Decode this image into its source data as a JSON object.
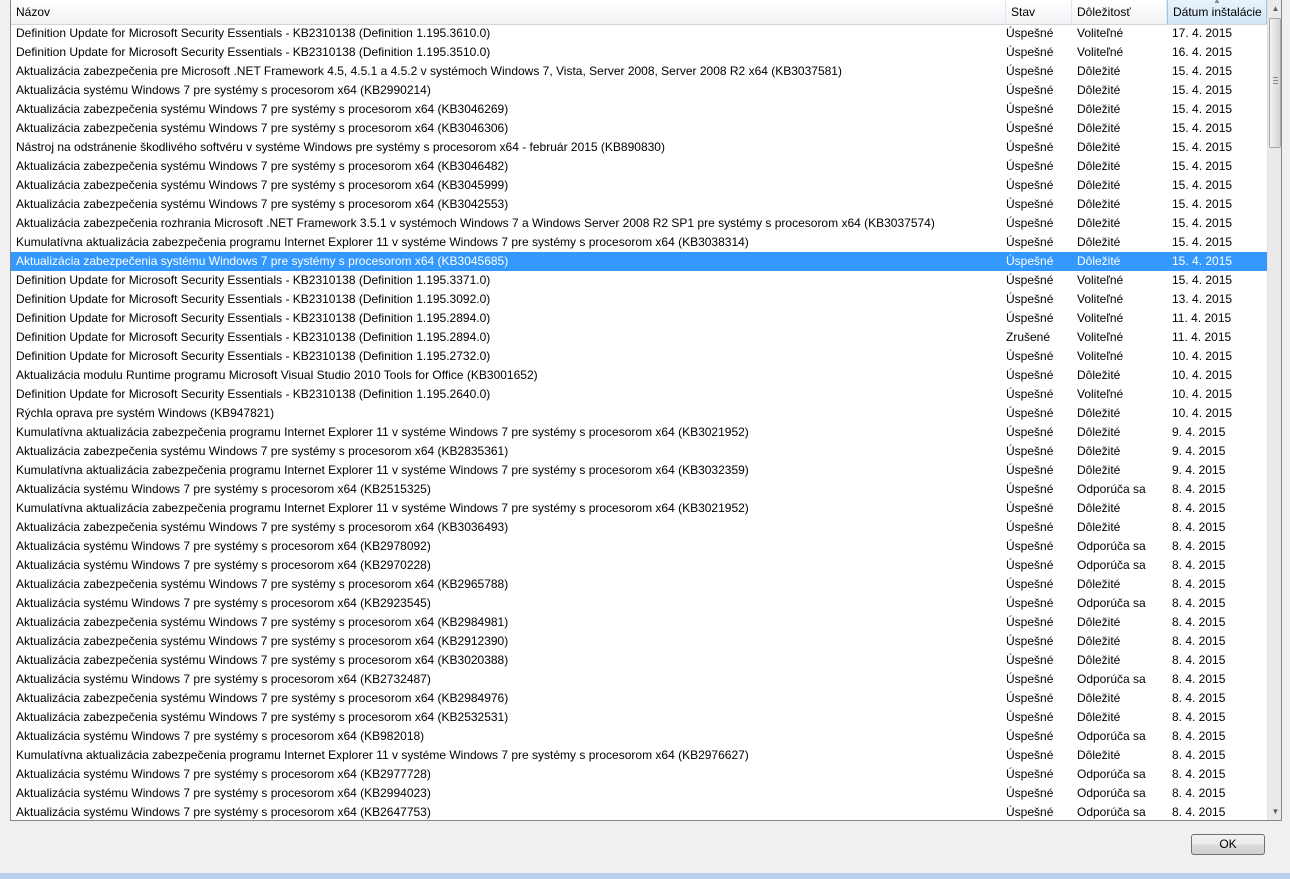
{
  "columns": {
    "name": "Názov",
    "stav": "Stav",
    "dolezitost": "Dôležitosť",
    "datum": "Dátum inštalácie"
  },
  "rows": [
    {
      "name": "Definition Update for Microsoft Security Essentials - KB2310138 (Definition 1.195.3610.0)",
      "stav": "Úspešné",
      "dol": "Voliteľné",
      "dat": "17. 4. 2015"
    },
    {
      "name": "Definition Update for Microsoft Security Essentials - KB2310138 (Definition 1.195.3510.0)",
      "stav": "Úspešné",
      "dol": "Voliteľné",
      "dat": "16. 4. 2015"
    },
    {
      "name": "Aktualizácia zabezpečenia pre Microsoft .NET Framework 4.5, 4.5.1 a 4.5.2 v systémoch Windows 7, Vista, Server 2008, Server 2008 R2 x64 (KB3037581)",
      "stav": "Úspešné",
      "dol": "Dôležité",
      "dat": "15. 4. 2015"
    },
    {
      "name": "Aktualizácia systému Windows 7 pre systémy s procesorom x64 (KB2990214)",
      "stav": "Úspešné",
      "dol": "Dôležité",
      "dat": "15. 4. 2015"
    },
    {
      "name": "Aktualizácia zabezpečenia systému Windows 7 pre systémy s procesorom x64 (KB3046269)",
      "stav": "Úspešné",
      "dol": "Dôležité",
      "dat": "15. 4. 2015"
    },
    {
      "name": "Aktualizácia zabezpečenia systému Windows 7 pre systémy s procesorom x64 (KB3046306)",
      "stav": "Úspešné",
      "dol": "Dôležité",
      "dat": "15. 4. 2015"
    },
    {
      "name": "Nástroj na odstránenie škodlivého softvéru v systéme Windows pre systémy s procesorom x64 - február 2015 (KB890830)",
      "stav": "Úspešné",
      "dol": "Dôležité",
      "dat": "15. 4. 2015"
    },
    {
      "name": "Aktualizácia zabezpečenia systému Windows 7 pre systémy s procesorom x64 (KB3046482)",
      "stav": "Úspešné",
      "dol": "Dôležité",
      "dat": "15. 4. 2015"
    },
    {
      "name": "Aktualizácia zabezpečenia systému Windows 7 pre systémy s procesorom x64 (KB3045999)",
      "stav": "Úspešné",
      "dol": "Dôležité",
      "dat": "15. 4. 2015"
    },
    {
      "name": "Aktualizácia zabezpečenia systému Windows 7 pre systémy s procesorom x64 (KB3042553)",
      "stav": "Úspešné",
      "dol": "Dôležité",
      "dat": "15. 4. 2015"
    },
    {
      "name": "Aktualizácia zabezpečenia rozhrania Microsoft .NET Framework 3.5.1 v systémoch Windows 7 a Windows Server 2008 R2 SP1 pre systémy s procesorom x64 (KB3037574)",
      "stav": "Úspešné",
      "dol": "Dôležité",
      "dat": "15. 4. 2015"
    },
    {
      "name": "Kumulatívna aktualizácia zabezpečenia programu Internet Explorer 11 v systéme Windows 7 pre systémy s procesorom x64 (KB3038314)",
      "stav": "Úspešné",
      "dol": "Dôležité",
      "dat": "15. 4. 2015"
    },
    {
      "name": "Aktualizácia zabezpečenia systému Windows 7 pre systémy s procesorom x64 (KB3045685)",
      "stav": "Úspešné",
      "dol": "Dôležité",
      "dat": "15. 4. 2015",
      "selected": true
    },
    {
      "name": "Definition Update for Microsoft Security Essentials - KB2310138 (Definition 1.195.3371.0)",
      "stav": "Úspešné",
      "dol": "Voliteľné",
      "dat": "15. 4. 2015"
    },
    {
      "name": "Definition Update for Microsoft Security Essentials - KB2310138 (Definition 1.195.3092.0)",
      "stav": "Úspešné",
      "dol": "Voliteľné",
      "dat": "13. 4. 2015"
    },
    {
      "name": "Definition Update for Microsoft Security Essentials - KB2310138 (Definition 1.195.2894.0)",
      "stav": "Úspešné",
      "dol": "Voliteľné",
      "dat": "11. 4. 2015"
    },
    {
      "name": "Definition Update for Microsoft Security Essentials - KB2310138 (Definition 1.195.2894.0)",
      "stav": "Zrušené",
      "dol": "Voliteľné",
      "dat": "11. 4. 2015"
    },
    {
      "name": "Definition Update for Microsoft Security Essentials - KB2310138 (Definition 1.195.2732.0)",
      "stav": "Úspešné",
      "dol": "Voliteľné",
      "dat": "10. 4. 2015"
    },
    {
      "name": "Aktualizácia modulu Runtime programu Microsoft Visual Studio 2010 Tools for Office (KB3001652)",
      "stav": "Úspešné",
      "dol": "Dôležité",
      "dat": "10. 4. 2015"
    },
    {
      "name": "Definition Update for Microsoft Security Essentials - KB2310138 (Definition 1.195.2640.0)",
      "stav": "Úspešné",
      "dol": "Voliteľné",
      "dat": "10. 4. 2015"
    },
    {
      "name": "Rýchla oprava pre systém Windows (KB947821)",
      "stav": "Úspešné",
      "dol": "Dôležité",
      "dat": "10. 4. 2015"
    },
    {
      "name": "Kumulatívna aktualizácia zabezpečenia programu Internet Explorer 11 v systéme Windows 7 pre systémy s procesorom x64 (KB3021952)",
      "stav": "Úspešné",
      "dol": "Dôležité",
      "dat": "9. 4. 2015"
    },
    {
      "name": "Aktualizácia zabezpečenia systému Windows 7 pre systémy s procesorom x64 (KB2835361)",
      "stav": "Úspešné",
      "dol": "Dôležité",
      "dat": "9. 4. 2015"
    },
    {
      "name": "Kumulatívna aktualizácia zabezpečenia programu Internet Explorer 11 v systéme Windows 7 pre systémy s procesorom x64 (KB3032359)",
      "stav": "Úspešné",
      "dol": "Dôležité",
      "dat": "9. 4. 2015"
    },
    {
      "name": "Aktualizácia systému Windows 7 pre systémy s procesorom x64 (KB2515325)",
      "stav": "Úspešné",
      "dol": "Odporúča sa",
      "dat": "8. 4. 2015"
    },
    {
      "name": "Kumulatívna aktualizácia zabezpečenia programu Internet Explorer 11 v systéme Windows 7 pre systémy s procesorom x64 (KB3021952)",
      "stav": "Úspešné",
      "dol": "Dôležité",
      "dat": "8. 4. 2015"
    },
    {
      "name": "Aktualizácia zabezpečenia systému Windows 7 pre systémy s procesorom x64 (KB3036493)",
      "stav": "Úspešné",
      "dol": "Dôležité",
      "dat": "8. 4. 2015"
    },
    {
      "name": "Aktualizácia systému Windows 7 pre systémy s procesorom x64 (KB2978092)",
      "stav": "Úspešné",
      "dol": "Odporúča sa",
      "dat": "8. 4. 2015"
    },
    {
      "name": "Aktualizácia systému Windows 7 pre systémy s procesorom x64 (KB2970228)",
      "stav": "Úspešné",
      "dol": "Odporúča sa",
      "dat": "8. 4. 2015"
    },
    {
      "name": "Aktualizácia zabezpečenia systému Windows 7 pre systémy s procesorom x64 (KB2965788)",
      "stav": "Úspešné",
      "dol": "Dôležité",
      "dat": "8. 4. 2015"
    },
    {
      "name": "Aktualizácia systému Windows 7 pre systémy s procesorom x64 (KB2923545)",
      "stav": "Úspešné",
      "dol": "Odporúča sa",
      "dat": "8. 4. 2015"
    },
    {
      "name": "Aktualizácia zabezpečenia systému Windows 7 pre systémy s procesorom x64 (KB2984981)",
      "stav": "Úspešné",
      "dol": "Dôležité",
      "dat": "8. 4. 2015"
    },
    {
      "name": "Aktualizácia zabezpečenia systému Windows 7 pre systémy s procesorom x64 (KB2912390)",
      "stav": "Úspešné",
      "dol": "Dôležité",
      "dat": "8. 4. 2015"
    },
    {
      "name": "Aktualizácia zabezpečenia systému Windows 7 pre systémy s procesorom x64 (KB3020388)",
      "stav": "Úspešné",
      "dol": "Dôležité",
      "dat": "8. 4. 2015"
    },
    {
      "name": "Aktualizácia systému Windows 7 pre systémy s procesorom x64 (KB2732487)",
      "stav": "Úspešné",
      "dol": "Odporúča sa",
      "dat": "8. 4. 2015"
    },
    {
      "name": "Aktualizácia zabezpečenia systému Windows 7 pre systémy s procesorom x64 (KB2984976)",
      "stav": "Úspešné",
      "dol": "Dôležité",
      "dat": "8. 4. 2015"
    },
    {
      "name": "Aktualizácia zabezpečenia systému Windows 7 pre systémy s procesorom x64 (KB2532531)",
      "stav": "Úspešné",
      "dol": "Dôležité",
      "dat": "8. 4. 2015"
    },
    {
      "name": "Aktualizácia systému Windows 7 pre systémy s procesorom x64 (KB982018)",
      "stav": "Úspešné",
      "dol": "Odporúča sa",
      "dat": "8. 4. 2015"
    },
    {
      "name": "Kumulatívna aktualizácia zabezpečenia programu Internet Explorer 11 v systéme Windows 7 pre systémy s procesorom x64 (KB2976627)",
      "stav": "Úspešné",
      "dol": "Dôležité",
      "dat": "8. 4. 2015"
    },
    {
      "name": "Aktualizácia systému Windows 7 pre systémy s procesorom x64 (KB2977728)",
      "stav": "Úspešné",
      "dol": "Odporúča sa",
      "dat": "8. 4. 2015"
    },
    {
      "name": "Aktualizácia systému Windows 7 pre systémy s procesorom x64 (KB2994023)",
      "stav": "Úspešné",
      "dol": "Odporúča sa",
      "dat": "8. 4. 2015"
    },
    {
      "name": "Aktualizácia systému Windows 7 pre systémy s procesorom x64 (KB2647753)",
      "stav": "Úspešné",
      "dol": "Odporúča sa",
      "dat": "8. 4. 2015"
    }
  ],
  "buttons": {
    "ok": "OK"
  },
  "icons": {
    "sort": "sort-up-arrow-icon",
    "scroll_up": "scroll-up-arrow-icon",
    "scroll_down": "scroll-down-arrow-icon"
  },
  "colors": {
    "selection": "#3399ff",
    "window_border": "#b9d1ea"
  }
}
